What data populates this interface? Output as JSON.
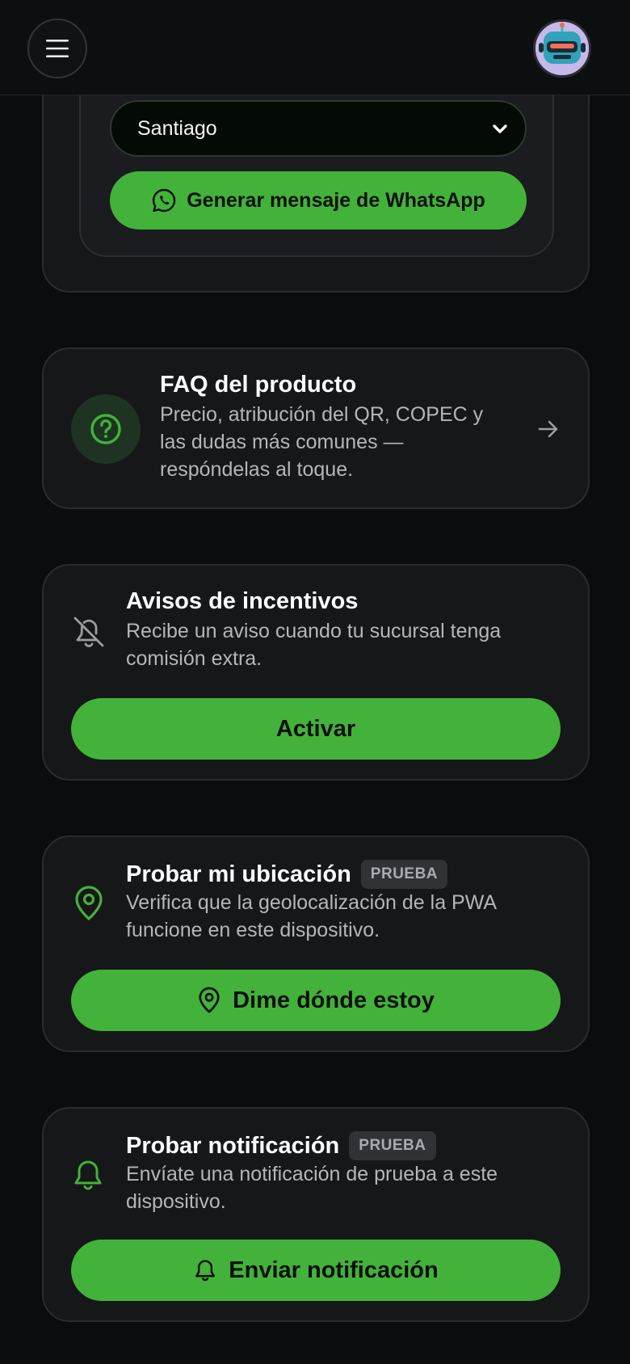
{
  "header": {
    "menu_icon": "hamburger-menu-icon",
    "avatar_icon": "robot-avatar-icon"
  },
  "region_card": {
    "select_value": "Santiago",
    "whatsapp_button": "Generar mensaje de WhatsApp"
  },
  "faq_card": {
    "title": "FAQ del producto",
    "desc_line1": "Precio, atribución del QR, COPEC y",
    "desc_line2": "las dudas más comunes —",
    "desc_line3": "respóndelas al toque."
  },
  "incentives_card": {
    "title": "Avisos de incentivos",
    "desc_line1": "Recibe un aviso cuando tu sucursal tenga",
    "desc_line2": "comisión extra.",
    "button": "Activar"
  },
  "location_card": {
    "title": "Probar mi ubicación",
    "badge": "PRUEBA",
    "desc_line1": "Verifica que la geolocalización de la PWA",
    "desc_line2": "funcione en este dispositivo.",
    "button": "Dime dónde estoy"
  },
  "notification_card": {
    "title": "Probar notificación",
    "badge": "PRUEBA",
    "desc_line1": "Envíate una notificación de prueba a este",
    "desc_line2": "dispositivo.",
    "button": "Enviar notificación"
  },
  "colors": {
    "accent_green": "#43b23a",
    "background": "#0b0c0e",
    "card": "#161719"
  }
}
